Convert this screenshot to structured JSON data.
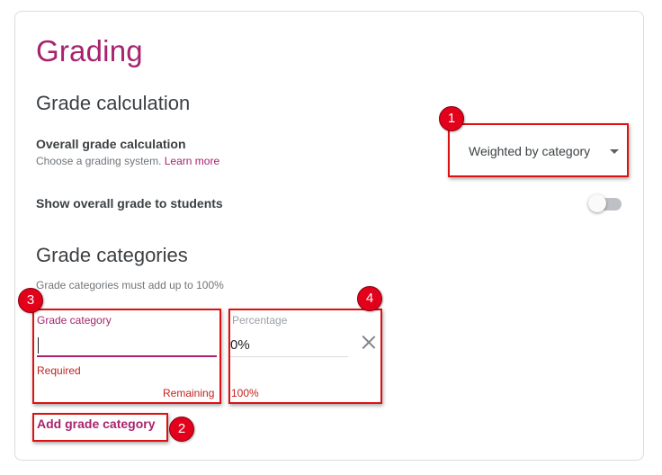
{
  "page": {
    "title": "Grading"
  },
  "grade_calculation": {
    "section_title": "Grade calculation",
    "overall_label": "Overall grade calculation",
    "overall_sub": "Choose a grading system.",
    "learn_more": "Learn more",
    "selected_system": "Weighted by category",
    "show_overall_label": "Show overall grade to students",
    "show_overall_enabled": false
  },
  "grade_categories": {
    "section_title": "Grade categories",
    "hint": "Grade categories must add up to 100%",
    "category_field_label": "Grade category",
    "category_value": "",
    "required_error": "Required",
    "remaining_label": "Remaining",
    "percentage_field_label": "Percentage",
    "percentage_value": "0%",
    "remaining_value": "100%",
    "add_button": "Add grade category"
  },
  "annotations": {
    "m1": "1",
    "m2": "2",
    "m3": "3",
    "m4": "4"
  },
  "colors": {
    "accent": "#a8236e",
    "error": "#c5221f",
    "annotation": "#e3001b"
  },
  "icons": {
    "dropdown": "caret-down-icon",
    "remove": "close-icon"
  }
}
